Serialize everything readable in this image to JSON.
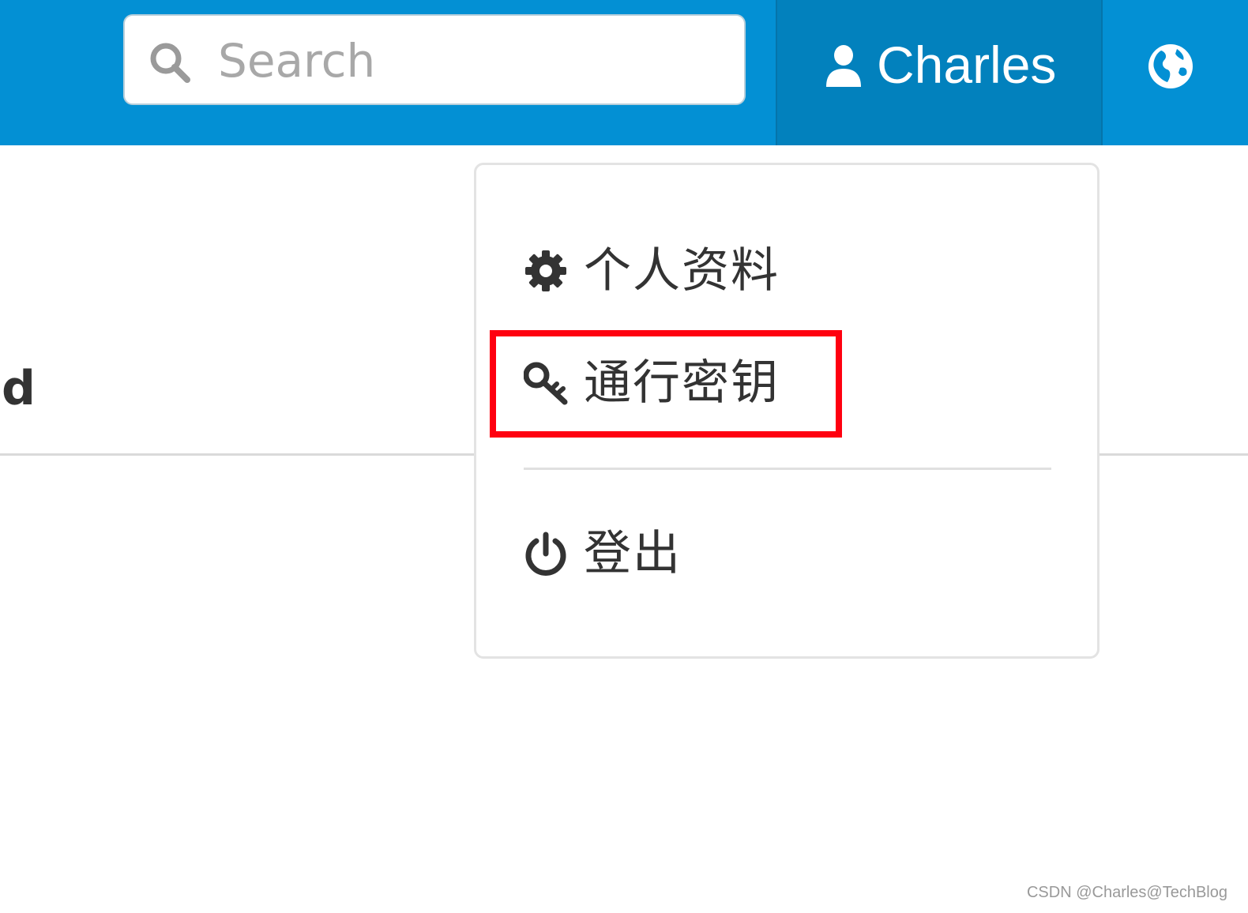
{
  "header": {
    "background_color": "#0390d4",
    "search": {
      "icon": "search-icon",
      "placeholder": "Search",
      "value": ""
    },
    "user_menu": {
      "icon": "user-icon",
      "name": "Charles",
      "background_color": "#0281bd"
    },
    "language_icon": "globe-icon"
  },
  "content": {
    "heading_fragment": "d"
  },
  "user_dropdown": {
    "items": [
      {
        "icon": "gear-icon",
        "label": "个人资料"
      },
      {
        "icon": "key-icon",
        "label": "通行密钥",
        "highlighted": true
      },
      {
        "icon": "power-icon",
        "label": "登出"
      }
    ]
  },
  "annotation": {
    "highlight_color": "#ff0010"
  },
  "watermark": {
    "text": "CSDN @Charles@TechBlog"
  }
}
